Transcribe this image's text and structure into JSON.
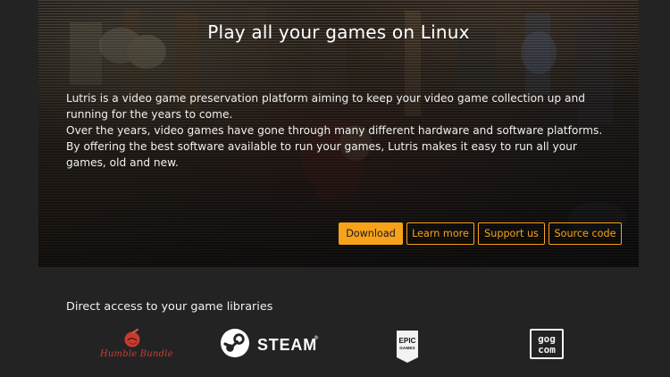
{
  "hero": {
    "title": "Play all your games on Linux",
    "paragraphs": [
      "Lutris is a video game preservation platform aiming to keep your video game collection up and running for the years to come.",
      "Over the years, video games have gone through many different hardware and software platforms. By offering the best software available to run your games, Lutris makes it easy to run all your games, old and new."
    ],
    "buttons": {
      "download": "Download",
      "learn_more": "Learn more",
      "support_us": "Support us",
      "source_code": "Source code"
    }
  },
  "libraries": {
    "title": "Direct access to your game libraries",
    "logos": {
      "humble": {
        "label": "Humble Bundle",
        "icon": "humble-bundle-logo"
      },
      "steam": {
        "label": "STEAM",
        "icon": "steam-logo"
      },
      "epic": {
        "label": "EPIC",
        "sublabel": "GAMES",
        "icon": "epic-games-logo"
      },
      "gog": {
        "label_top": "gog",
        "label_bottom": "com",
        "icon": "gog-logo"
      }
    }
  },
  "colors": {
    "accent": "#f7a21a",
    "background": "#232323",
    "hero_text": "#f0f0f0"
  }
}
